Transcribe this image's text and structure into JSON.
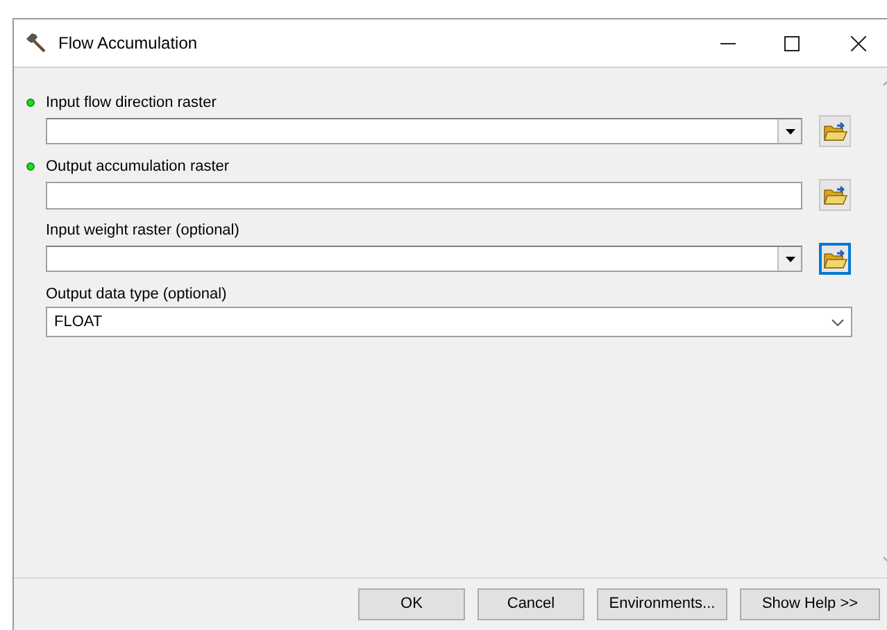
{
  "window": {
    "title": "Flow Accumulation"
  },
  "parameters": [
    {
      "label": "Input flow direction raster",
      "required": true,
      "kind": "combo",
      "focused": false
    },
    {
      "label": "Output accumulation raster",
      "required": true,
      "kind": "text",
      "focused": false
    },
    {
      "label": "Input weight raster (optional)",
      "required": false,
      "kind": "combo",
      "focused": true
    },
    {
      "label": "Output data type (optional)",
      "required": false,
      "kind": "select",
      "value": "FLOAT",
      "focused": false
    }
  ],
  "buttons": [
    "OK",
    "Cancel",
    "Environments...",
    "Show Help >>"
  ]
}
